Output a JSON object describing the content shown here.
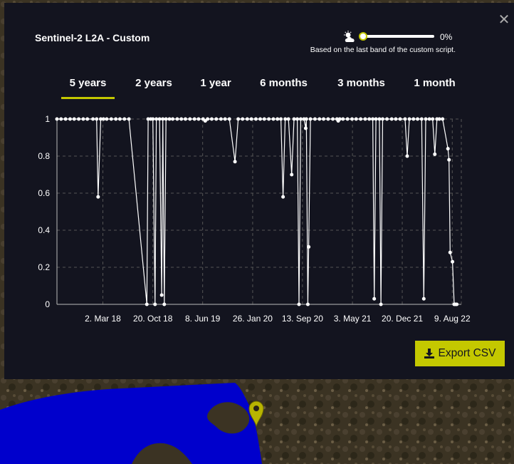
{
  "panel": {
    "title": "Sentinel-2 L2A - Custom",
    "close_icon": "close-icon",
    "cloud_icon": "cloud-sun-icon",
    "cloud_coverage": {
      "fraction": 0.0,
      "label": "0%"
    },
    "note": "Based on the last band of the custom script."
  },
  "tabs": [
    {
      "label": "5 years",
      "active": true
    },
    {
      "label": "2 years",
      "active": false
    },
    {
      "label": "1 year",
      "active": false
    },
    {
      "label": "6 months",
      "active": false
    },
    {
      "label": "3 months",
      "active": false
    },
    {
      "label": "1 month",
      "active": false
    }
  ],
  "export": {
    "label": "Export CSV",
    "icon": "download-icon"
  },
  "map_marker": {
    "icon": "map-pin-icon"
  },
  "colors": {
    "accent": "#c4c800",
    "panel_bg": "#13141f",
    "water": "#0000cc"
  },
  "chart_data": {
    "type": "line",
    "ylim": [
      0,
      1
    ],
    "xlim": [
      "2017-08-01",
      "2022-09-20"
    ],
    "yticks": [
      "0",
      "0.2",
      "0.4",
      "0.6",
      "0.8",
      "1"
    ],
    "xticks": [
      {
        "date": "2018-03-02",
        "label": "2. Mar 18"
      },
      {
        "date": "2018-10-20",
        "label": "20. Oct 18"
      },
      {
        "date": "2019-06-08",
        "label": "8. Jun 19"
      },
      {
        "date": "2020-01-26",
        "label": "26. Jan 20"
      },
      {
        "date": "2020-09-13",
        "label": "13. Sep 20"
      },
      {
        "date": "2021-05-03",
        "label": "3. May 21"
      },
      {
        "date": "2021-12-20",
        "label": "20. Dec 21"
      },
      {
        "date": "2022-08-09",
        "label": "9. Aug 22"
      }
    ],
    "grid": true,
    "series": [
      {
        "points": [
          [
            "2017-08-01",
            1
          ],
          [
            "2017-08-20",
            1
          ],
          [
            "2017-09-10",
            1
          ],
          [
            "2017-10-01",
            1
          ],
          [
            "2017-10-20",
            1
          ],
          [
            "2017-11-10",
            1
          ],
          [
            "2017-12-01",
            1
          ],
          [
            "2017-12-20",
            1
          ],
          [
            "2018-01-15",
            1
          ],
          [
            "2018-02-01",
            1
          ],
          [
            "2018-02-08",
            0.58
          ],
          [
            "2018-02-20",
            1
          ],
          [
            "2018-03-05",
            1
          ],
          [
            "2018-03-20",
            1
          ],
          [
            "2018-04-10",
            1
          ],
          [
            "2018-05-01",
            1
          ],
          [
            "2018-05-20",
            1
          ],
          [
            "2018-06-10",
            1
          ],
          [
            "2018-07-01",
            1
          ],
          [
            "2018-09-22",
            0
          ],
          [
            "2018-09-28",
            1
          ],
          [
            "2018-10-10",
            1
          ],
          [
            "2018-10-20",
            1
          ],
          [
            "2018-10-30",
            0
          ],
          [
            "2018-11-05",
            1
          ],
          [
            "2018-11-20",
            1
          ],
          [
            "2018-11-30",
            0.05
          ],
          [
            "2018-12-05",
            1
          ],
          [
            "2018-12-12",
            0
          ],
          [
            "2018-12-20",
            1
          ],
          [
            "2019-01-05",
            1
          ],
          [
            "2019-01-20",
            1
          ],
          [
            "2019-02-10",
            1
          ],
          [
            "2019-03-01",
            1
          ],
          [
            "2019-03-20",
            1
          ],
          [
            "2019-04-10",
            1
          ],
          [
            "2019-05-01",
            1
          ],
          [
            "2019-05-20",
            1
          ],
          [
            "2019-06-10",
            1
          ],
          [
            "2019-06-20",
            0.99
          ],
          [
            "2019-07-01",
            1
          ],
          [
            "2019-07-20",
            1
          ],
          [
            "2019-08-10",
            1
          ],
          [
            "2019-09-01",
            1
          ],
          [
            "2019-09-20",
            1
          ],
          [
            "2019-10-10",
            1
          ],
          [
            "2019-11-05",
            0.77
          ],
          [
            "2019-11-20",
            1
          ],
          [
            "2019-12-10",
            1
          ],
          [
            "2020-01-01",
            1
          ],
          [
            "2020-01-20",
            1
          ],
          [
            "2020-02-10",
            1
          ],
          [
            "2020-03-01",
            1
          ],
          [
            "2020-03-20",
            1
          ],
          [
            "2020-04-10",
            1
          ],
          [
            "2020-05-01",
            1
          ],
          [
            "2020-05-20",
            1
          ],
          [
            "2020-06-05",
            1
          ],
          [
            "2020-06-15",
            0.58
          ],
          [
            "2020-06-25",
            1
          ],
          [
            "2020-07-10",
            1
          ],
          [
            "2020-07-25",
            0.7
          ],
          [
            "2020-08-05",
            1
          ],
          [
            "2020-08-20",
            1
          ],
          [
            "2020-08-28",
            0
          ],
          [
            "2020-09-05",
            1
          ],
          [
            "2020-09-20",
            1
          ],
          [
            "2020-09-28",
            0.95
          ],
          [
            "2020-10-01",
            1
          ],
          [
            "2020-10-08",
            0
          ],
          [
            "2020-10-12",
            0.31
          ],
          [
            "2020-10-20",
            1
          ],
          [
            "2020-11-10",
            1
          ],
          [
            "2020-12-01",
            1
          ],
          [
            "2020-12-20",
            1
          ],
          [
            "2021-01-10",
            1
          ],
          [
            "2021-02-01",
            1
          ],
          [
            "2021-02-20",
            1
          ],
          [
            "2021-02-26",
            0.99
          ],
          [
            "2021-03-05",
            1
          ],
          [
            "2021-03-20",
            1
          ],
          [
            "2021-04-10",
            1
          ],
          [
            "2021-05-01",
            1
          ],
          [
            "2021-05-20",
            1
          ],
          [
            "2021-06-10",
            1
          ],
          [
            "2021-07-01",
            1
          ],
          [
            "2021-07-20",
            1
          ],
          [
            "2021-08-05",
            1
          ],
          [
            "2021-08-12",
            0.03
          ],
          [
            "2021-08-20",
            1
          ],
          [
            "2021-09-05",
            1
          ],
          [
            "2021-09-12",
            0
          ],
          [
            "2021-09-20",
            1
          ],
          [
            "2021-10-10",
            1
          ],
          [
            "2021-11-01",
            1
          ],
          [
            "2021-11-20",
            1
          ],
          [
            "2021-12-10",
            1
          ],
          [
            "2022-01-02",
            1
          ],
          [
            "2022-01-12",
            0.8
          ],
          [
            "2022-01-22",
            1
          ],
          [
            "2022-02-10",
            1
          ],
          [
            "2022-03-01",
            1
          ],
          [
            "2022-03-20",
            1
          ],
          [
            "2022-03-30",
            0.03
          ],
          [
            "2022-04-08",
            1
          ],
          [
            "2022-04-25",
            1
          ],
          [
            "2022-05-10",
            1
          ],
          [
            "2022-05-20",
            0.81
          ],
          [
            "2022-05-30",
            1
          ],
          [
            "2022-06-10",
            1
          ],
          [
            "2022-06-25",
            1
          ],
          [
            "2022-07-20",
            0.84
          ],
          [
            "2022-07-25",
            0.78
          ],
          [
            "2022-07-30",
            0.28
          ],
          [
            "2022-08-10",
            0.23
          ],
          [
            "2022-08-18",
            0
          ],
          [
            "2022-08-24",
            0
          ],
          [
            "2022-08-30",
            0
          ]
        ]
      }
    ]
  }
}
